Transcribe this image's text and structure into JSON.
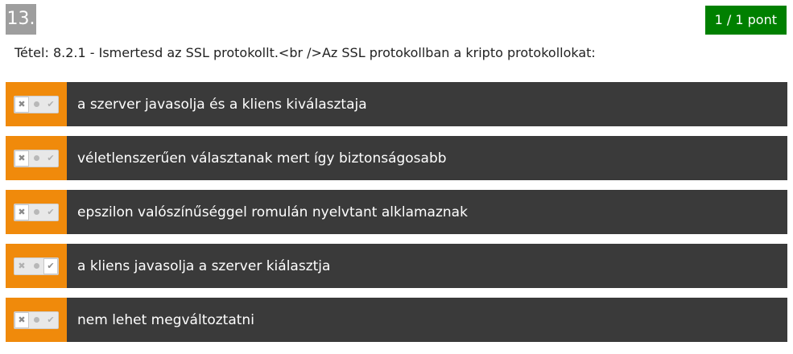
{
  "question": {
    "number": "13.",
    "points": "1 / 1 pont",
    "text": "Tétel: 8.2.1 - Ismertesd az SSL protokollt.<br />Az SSL protokollban a kripto protokollokat:"
  },
  "answers": [
    {
      "text": "a szerver javasolja és a kliens kiválasztaja",
      "state": "false"
    },
    {
      "text": "véletlenszerűen választanak mert így biztonságosabb",
      "state": "false"
    },
    {
      "text": "epszilon valószínűséggel romulán nyelvtant alklamaznak",
      "state": "false"
    },
    {
      "text": "a kliens javasolja a szerver kiálasztja",
      "state": "true"
    },
    {
      "text": "nem lehet megváltoztatni",
      "state": "false"
    }
  ],
  "icons": {
    "false": "cross-icon",
    "neutral": "dot-icon",
    "true": "check-icon"
  },
  "colors": {
    "toggle_background": "#f08a0b",
    "answer_background": "#3a3a3a",
    "points_badge": "#008000",
    "question_number": "#9e9e9e"
  }
}
